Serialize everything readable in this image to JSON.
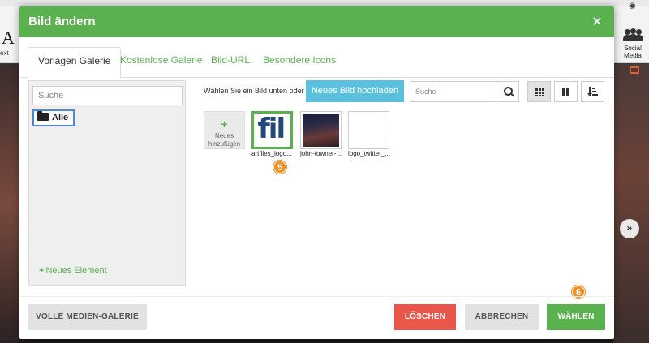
{
  "background": {
    "left_letter": "A",
    "left_text": "ext",
    "social_label_line1": "Social",
    "social_label_line2": "Media"
  },
  "modal": {
    "title": "Bild ändern",
    "close_symbol": "✕"
  },
  "tabs": [
    {
      "label": "Vorlagen Galerie",
      "active": true
    },
    {
      "label": "Kostenlose Galerie",
      "active": false
    },
    {
      "label": "Bild-URL",
      "active": false
    },
    {
      "label": "Besondere Icons",
      "active": false
    }
  ],
  "left_panel": {
    "search_placeholder": "Suche",
    "folder_label": "Alle",
    "new_element_plus": "+",
    "new_element_label": "Neues Element"
  },
  "toolbar": {
    "choose_text": "Wählen Sie ein Bild unten oder",
    "upload_label": "Neues Bild hochladen",
    "search_placeholder": "Suche"
  },
  "gallery": {
    "add_plus": "+",
    "add_label_line1": "Neues",
    "add_label_line2": "hinzufügen",
    "logo_text": "fil",
    "items": [
      {
        "caption": "artfiles_logo...",
        "selected": true
      },
      {
        "caption": "john-towner-...",
        "selected": false
      },
      {
        "caption": "logo_twitter_...",
        "selected": false
      }
    ]
  },
  "badges": {
    "step5": "5",
    "step6": "6"
  },
  "footer": {
    "gallery_label": "VOLLE MEDIEN-GALERIE",
    "delete_label": "LÖSCHEN",
    "cancel_label": "ABBRECHEN",
    "select_label": "WÄHLEN"
  },
  "colors": {
    "header_green": "#5ab24f",
    "upload_blue": "#5bc0de",
    "delete_red": "#e8574a",
    "badge_orange": "#f28c1f"
  },
  "icons": {
    "close": "close-icon",
    "folder": "folder-open-icon",
    "search": "search-icon",
    "grid_small": "grid-view-icon",
    "grid_large": "tile-view-icon",
    "sort": "sort-icon",
    "next": "chevron-right-circle-icon"
  }
}
